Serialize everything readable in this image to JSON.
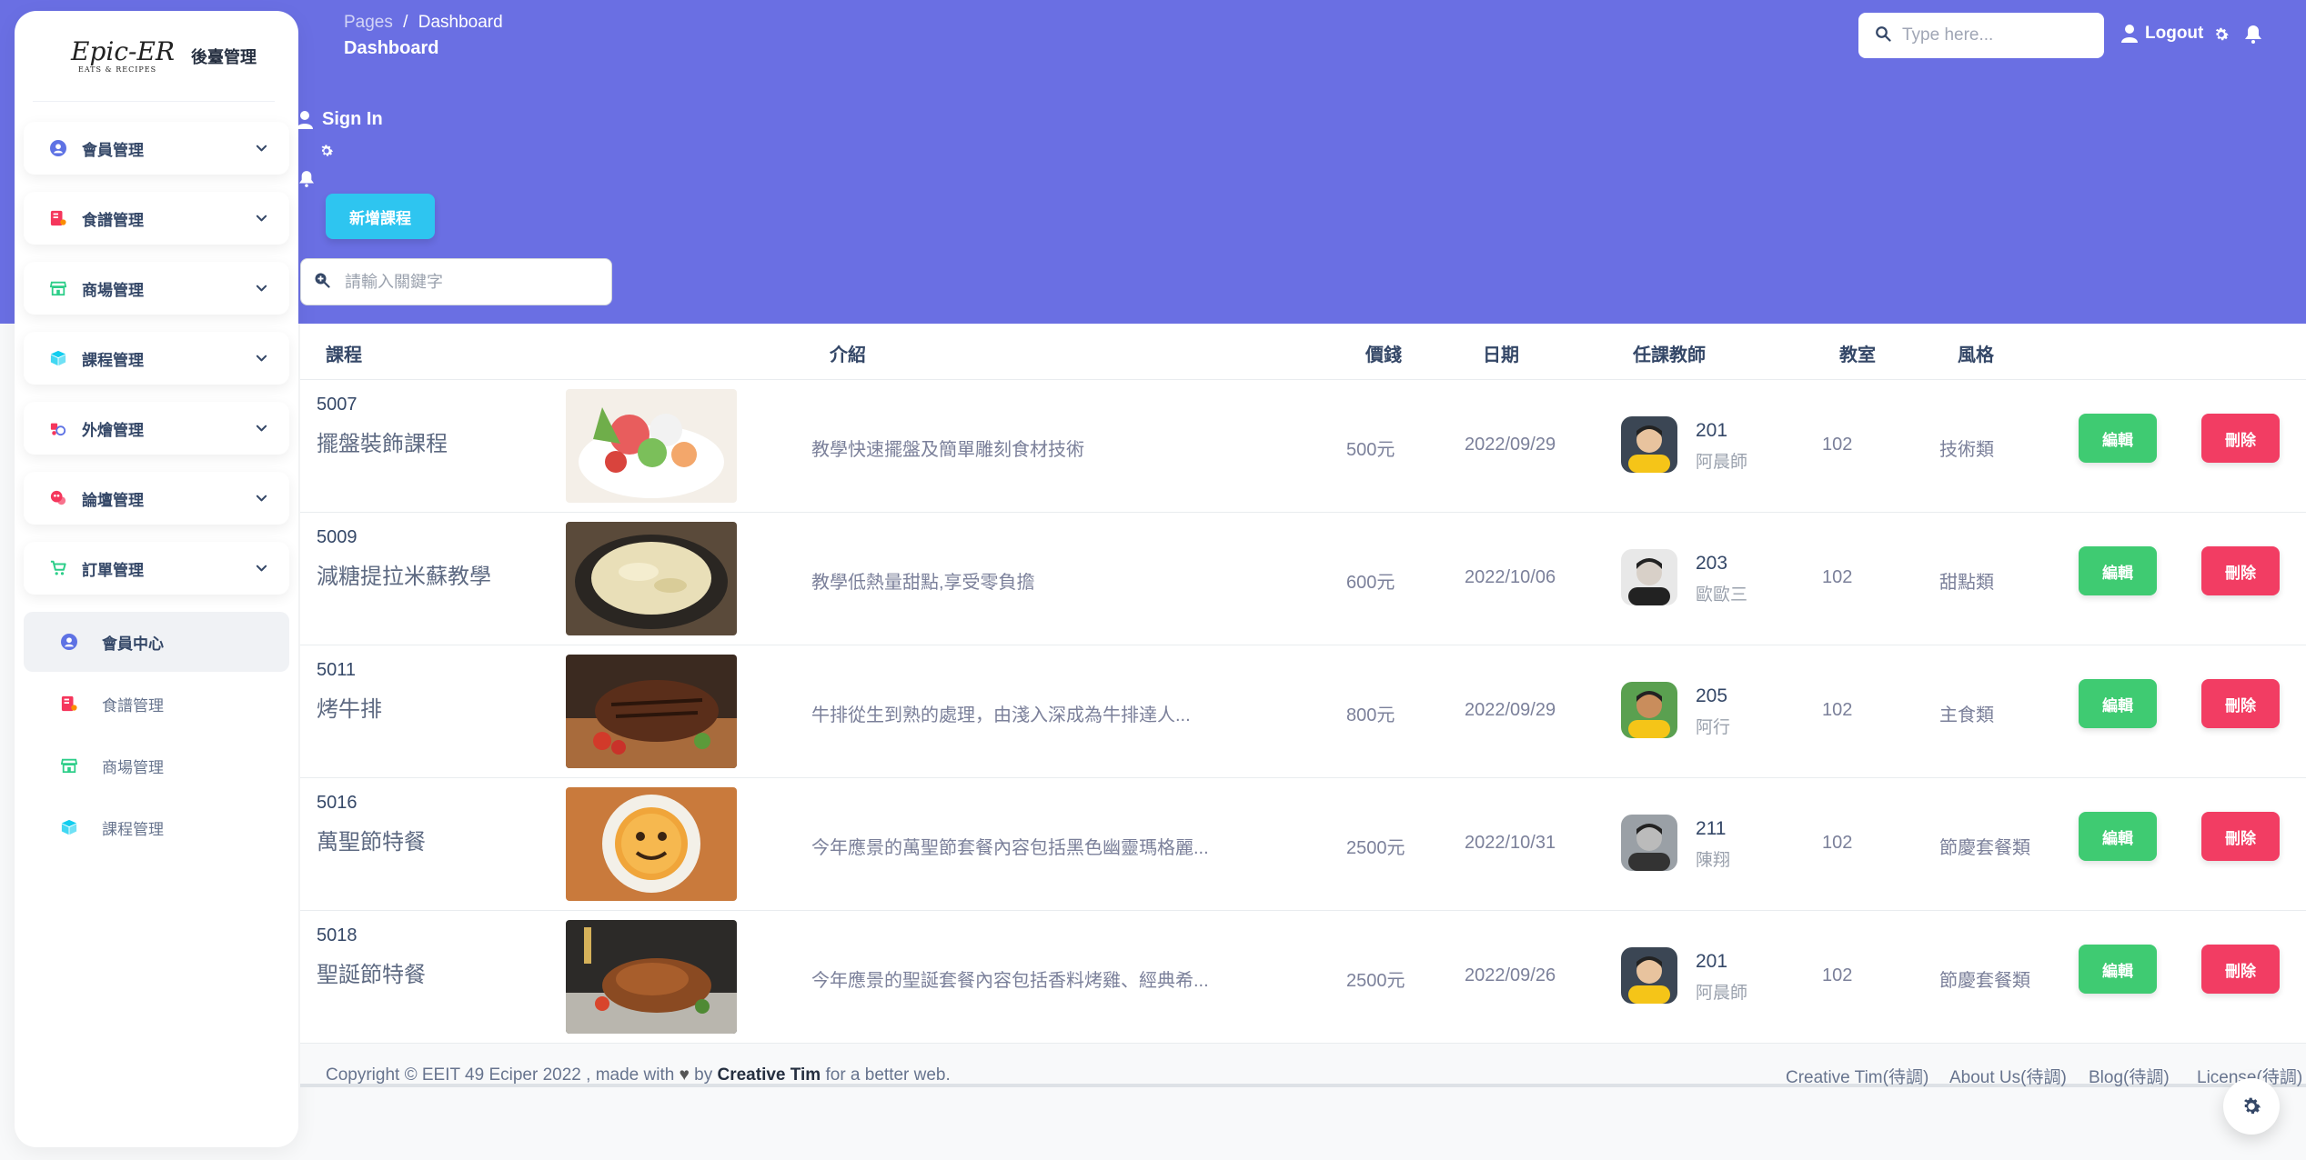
{
  "brand": {
    "logo_text": "Epic-ER",
    "logo_sub": "EATS & RECIPES",
    "title": "後臺管理"
  },
  "sidebar": {
    "items": [
      {
        "label": "會員管理",
        "icon": "user-circle-icon",
        "color": "#5e72e4"
      },
      {
        "label": "食譜管理",
        "icon": "recipe-book-icon",
        "color": "#f5365c"
      },
      {
        "label": "商場管理",
        "icon": "store-icon",
        "color": "#2dce89"
      },
      {
        "label": "課程管理",
        "icon": "box-icon",
        "color": "#11cdef"
      },
      {
        "label": "外燴管理",
        "icon": "delivery-icon",
        "color": "#f5365c"
      },
      {
        "label": "論壇管理",
        "icon": "forum-icon",
        "color": "#f5365c"
      },
      {
        "label": "訂單管理",
        "icon": "cart-icon",
        "color": "#2dce89"
      }
    ],
    "sub_items": [
      {
        "label": "會員中心",
        "icon": "user-circle-icon",
        "color": "#5e72e4"
      },
      {
        "label": "食譜管理",
        "icon": "recipe-book-icon",
        "color": "#f5365c"
      },
      {
        "label": "商場管理",
        "icon": "store-icon",
        "color": "#2dce89"
      },
      {
        "label": "課程管理",
        "icon": "box-icon",
        "color": "#11cdef"
      }
    ]
  },
  "nav": {
    "breadcrumb_parent": "Pages",
    "breadcrumb_sep": "/",
    "breadcrumb_current": "Dashboard",
    "page_title": "Dashboard",
    "search_placeholder": "Type here...",
    "logout_label": "Logout",
    "signin_label": "Sign In"
  },
  "toolbar": {
    "add_label": "新增課程",
    "keyword_placeholder": "請輸入關鍵字"
  },
  "table": {
    "headers": {
      "course": "課程",
      "intro": "介紹",
      "price": "價錢",
      "date": "日期",
      "teacher": "任課教師",
      "room": "教室",
      "style": "風格"
    },
    "edit_label": "編輯",
    "delete_label": "刪除",
    "rows": [
      {
        "id": "5007",
        "name": "擺盤裝飾課程",
        "intro": "教學快速擺盤及簡單雕刻食材技術",
        "price": "500元",
        "date": "2022/09/29",
        "teacher_id": "201",
        "teacher_name": "阿晨師",
        "room": "102",
        "style": "技術類",
        "thumb": "plating",
        "avatar": "yellow"
      },
      {
        "id": "5009",
        "name": "減糖提拉米蘇教學",
        "intro": "教學低熱量甜點,享受零負擔",
        "price": "600元",
        "date": "2022/10/06",
        "teacher_id": "203",
        "teacher_name": "歐歐三",
        "room": "102",
        "style": "甜點類",
        "thumb": "tiramisu",
        "avatar": "gray"
      },
      {
        "id": "5011",
        "name": "烤牛排",
        "intro": "牛排從生到熟的處理，由淺入深成為牛排達人...",
        "price": "800元",
        "date": "2022/09/29",
        "teacher_id": "205",
        "teacher_name": "阿行",
        "room": "102",
        "style": "主食類",
        "thumb": "steak",
        "avatar": "green"
      },
      {
        "id": "5016",
        "name": "萬聖節特餐",
        "intro": "今年應景的萬聖節套餐內容包括黑色幽靈瑪格麗...",
        "price": "2500元",
        "date": "2022/10/31",
        "teacher_id": "211",
        "teacher_name": "陳翔",
        "room": "102",
        "style": "節慶套餐類",
        "thumb": "pumpkin",
        "avatar": "bw"
      },
      {
        "id": "5018",
        "name": "聖誕節特餐",
        "intro": "今年應景的聖誕套餐內容包括香料烤雞、經典希...",
        "price": "2500元",
        "date": "2022/09/26",
        "teacher_id": "201",
        "teacher_name": "阿晨師",
        "room": "102",
        "style": "節慶套餐類",
        "thumb": "roast",
        "avatar": "yellow"
      }
    ]
  },
  "footer": {
    "copy_prefix": "Copyright © EEIT 49 Eciper 2022 , made with",
    "copy_by": "by",
    "copy_brand": "Creative Tim",
    "copy_suffix": "for a better web.",
    "links": [
      "Creative Tim(待調)",
      "About Us(待調)",
      "Blog(待調)",
      "License(待調)"
    ]
  },
  "colors": {
    "hero": "#6a6fe3",
    "add_button": "#2ec5f0",
    "edit_button": "#3fcb72",
    "delete_button": "#f23d63"
  }
}
